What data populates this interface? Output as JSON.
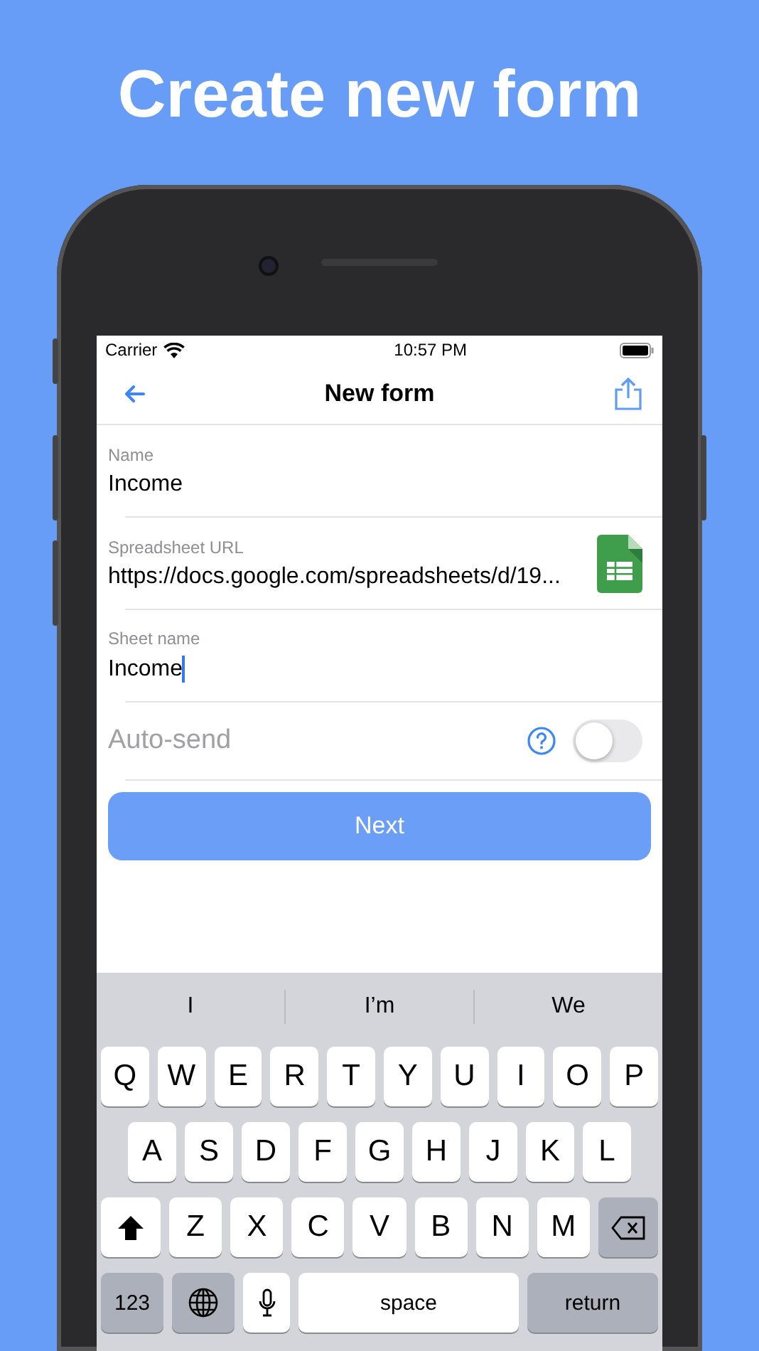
{
  "headline": "Create new form",
  "status_bar": {
    "carrier": "Carrier",
    "time": "10:57 PM"
  },
  "nav": {
    "title": "New form"
  },
  "fields": [
    {
      "kind": "text",
      "label": "Name",
      "value": "Income",
      "focused": false
    },
    {
      "kind": "url",
      "label": "Spreadsheet URL",
      "value": "https://docs.google.com/spreadsheets/d/19...",
      "focused": false
    },
    {
      "kind": "text",
      "label": "Sheet name",
      "value": "Income",
      "focused": true
    }
  ],
  "auto_send": {
    "label": "Auto-send",
    "on": false
  },
  "primary_button": "Next",
  "keyboard": {
    "suggestions": [
      "I",
      "I’m",
      "We"
    ],
    "rows": [
      {
        "keys": [
          {
            "kind": "letter",
            "label": "Q"
          },
          {
            "kind": "letter",
            "label": "W"
          },
          {
            "kind": "letter",
            "label": "E"
          },
          {
            "kind": "letter",
            "label": "R"
          },
          {
            "kind": "letter",
            "label": "T"
          },
          {
            "kind": "letter",
            "label": "Y"
          },
          {
            "kind": "letter",
            "label": "U"
          },
          {
            "kind": "letter",
            "label": "I"
          },
          {
            "kind": "letter",
            "label": "O"
          },
          {
            "kind": "letter",
            "label": "P"
          }
        ]
      },
      {
        "keys": [
          {
            "kind": "letter",
            "label": "A"
          },
          {
            "kind": "letter",
            "label": "S"
          },
          {
            "kind": "letter",
            "label": "D"
          },
          {
            "kind": "letter",
            "label": "F"
          },
          {
            "kind": "letter",
            "label": "G"
          },
          {
            "kind": "letter",
            "label": "H"
          },
          {
            "kind": "letter",
            "label": "J"
          },
          {
            "kind": "letter",
            "label": "K"
          },
          {
            "kind": "letter",
            "label": "L"
          }
        ]
      },
      {
        "keys": [
          {
            "kind": "shift"
          },
          {
            "kind": "letter",
            "label": "Z"
          },
          {
            "kind": "letter",
            "label": "X"
          },
          {
            "kind": "letter",
            "label": "C"
          },
          {
            "kind": "letter",
            "label": "V"
          },
          {
            "kind": "letter",
            "label": "B"
          },
          {
            "kind": "letter",
            "label": "N"
          },
          {
            "kind": "letter",
            "label": "M"
          },
          {
            "kind": "delete"
          }
        ]
      },
      {
        "keys": [
          {
            "kind": "mode",
            "label": "123"
          },
          {
            "kind": "globe"
          },
          {
            "kind": "mic"
          },
          {
            "kind": "space",
            "label": "space"
          },
          {
            "kind": "return",
            "label": "return"
          }
        ]
      }
    ]
  }
}
